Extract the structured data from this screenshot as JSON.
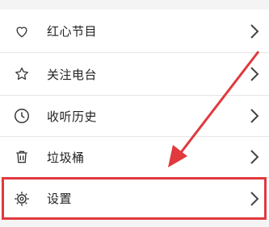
{
  "menu": {
    "items": [
      {
        "label": "红心节目",
        "icon": "heart-icon"
      },
      {
        "label": "关注电台",
        "icon": "star-icon"
      },
      {
        "label": "收听历史",
        "icon": "clock-icon"
      },
      {
        "label": "垃圾桶",
        "icon": "trash-icon"
      },
      {
        "label": "设置",
        "icon": "gear-icon"
      }
    ]
  },
  "annotation": {
    "highlight_color": "#e0393e",
    "arrow_color": "#e0393e"
  }
}
